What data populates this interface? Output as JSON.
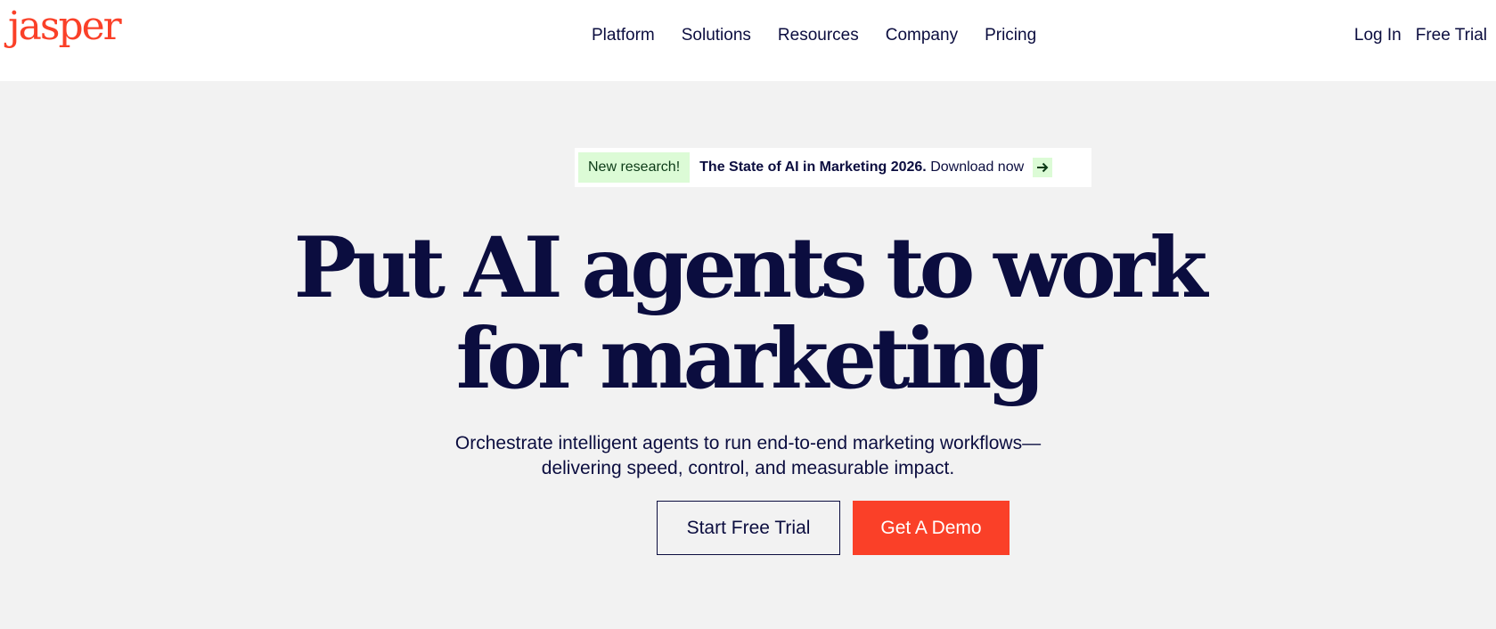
{
  "header": {
    "logo": "jasper",
    "nav": [
      "Platform",
      "Solutions",
      "Resources",
      "Company",
      "Pricing"
    ],
    "login": "Log In",
    "free_trial": "Free Trial"
  },
  "banner": {
    "badge": "New research!",
    "title": "The State of AI in Marketing 2026.",
    "link": "Download now",
    "arrow_icon": "arrow-right-icon"
  },
  "hero": {
    "title_line1": "Put AI agents to work",
    "title_line2": "for marketing",
    "subtitle_line1": "Orchestrate intelligent agents to run end-to-end marketing workflows—",
    "subtitle_line2": "delivering speed, control, and measurable impact.",
    "cta_trial": "Start Free Trial",
    "cta_demo": "Get A Demo"
  },
  "colors": {
    "brand": "#fa4028",
    "navy": "#0b0d3f",
    "badge_bg": "#dcfbd6",
    "page_bg": "#f2f2f2"
  }
}
